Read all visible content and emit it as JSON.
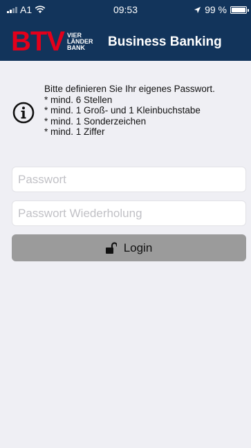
{
  "status_bar": {
    "carrier": "A1",
    "time": "09:53",
    "battery": "99 %",
    "battery_level": 0.99
  },
  "header": {
    "logo_mark": "BTV",
    "logo_sub": [
      "VIER",
      "LÄNDER",
      "BANK"
    ],
    "title": "Business Banking",
    "background": "#12345b",
    "logo_color": "#e3001b"
  },
  "info": {
    "icon": "info-circle-icon",
    "lines": [
      "Bitte definieren Sie Ihr eigenes Passwort.",
      "* mind. 6 Stellen",
      "* mind. 1 Groß- und 1 Kleinbuchstabe",
      "* mind. 1 Sonderzeichen",
      "* mind. 1 Ziffer"
    ]
  },
  "form": {
    "password_placeholder": "Passwort",
    "password_value": "",
    "password_repeat_placeholder": "Passwort Wiederholung",
    "password_repeat_value": "",
    "login_label": "Login",
    "login_icon": "unlock-icon"
  }
}
